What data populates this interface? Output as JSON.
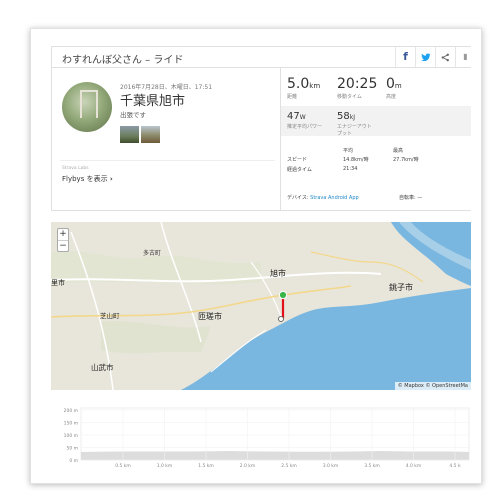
{
  "header": {
    "title": "わすれんぼ父さん – ライド",
    "share_icons": [
      "facebook-icon",
      "twitter-icon",
      "share-icon",
      "like-icon"
    ]
  },
  "activity": {
    "date": "2016年7月28日、木曜日、17:51",
    "location": "千葉県旭市",
    "description": "出張です",
    "flybys_label": "Strava Labs",
    "flybys_link": "Flybys を表示",
    "flybys_chevron": "›"
  },
  "stats": {
    "distance": {
      "value": "5.0",
      "unit": "km",
      "label": "距離"
    },
    "moving_time": {
      "value": "20:25",
      "label": "移動タイム"
    },
    "elevation": {
      "value": "0",
      "unit": "m",
      "label": "高度"
    },
    "power": {
      "value": "47",
      "unit": "W",
      "label": "推定平均パワー"
    },
    "energy": {
      "value": "58",
      "unit": "kJ",
      "label_line1": "エナジーアウト",
      "label_line2": "プット"
    },
    "table": {
      "headers": {
        "avg": "平均",
        "max": "最高"
      },
      "speed": {
        "label": "スピード",
        "avg": "14.8km/時",
        "max": "27.7km/時"
      },
      "elapsed": {
        "label": "経過タイム",
        "avg": "21:34"
      }
    },
    "device_label": "デバイス:",
    "device_value": "Strava Android App",
    "bike_label": "自転車:",
    "bike_value": "—"
  },
  "map": {
    "zoom_in": "+",
    "zoom_out": "−",
    "attribution": "© Mapbox © OpenStreetMa",
    "labels": {
      "asahi": "旭市",
      "choshi": "銚子市",
      "sosa": "匝瑳市",
      "shibayama": "芝山町",
      "sanmu": "山武市",
      "tako": "多古町",
      "sato": "里市"
    },
    "colors": {
      "land": "#e8e5da",
      "sea": "#79b7e0",
      "route": "#e3111b",
      "start": "#3ab54a"
    }
  },
  "elevation_chart": {
    "y_ticks": [
      "200 m",
      "150 m",
      "100 m",
      "50 m",
      "0 m"
    ],
    "x_ticks": [
      "0.5 km",
      "1.0 km",
      "1.5 km",
      "2.0 km",
      "2.5 km",
      "3.0 km",
      "3.5 km",
      "4.0 km",
      "4.5 k"
    ]
  }
}
